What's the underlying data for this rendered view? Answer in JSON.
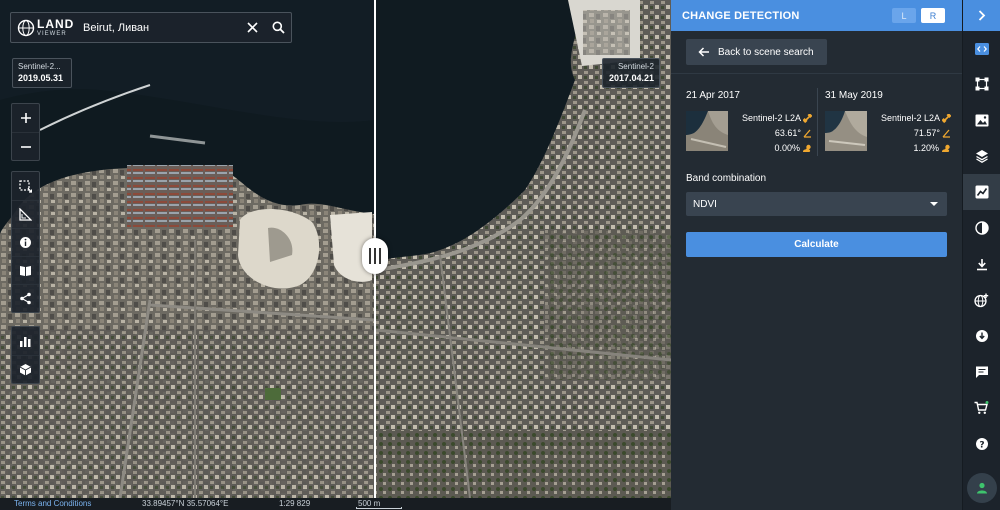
{
  "search": {
    "value": "Beirut, Ливан",
    "logo_line1": "LAND",
    "logo_line2": "VIEWER"
  },
  "map": {
    "left_scene": {
      "source": "Sentinel-2...",
      "date": "2019.05.31"
    },
    "right_scene": {
      "source": "Sentinel-2",
      "date": "2017.04.21"
    },
    "toolbar_top": [
      "zoom-in-icon",
      "zoom-out-icon"
    ],
    "toolbar_mid": [
      "select-area-icon",
      "ruler-icon",
      "info-icon",
      "book-icon",
      "share-icon"
    ],
    "toolbar_bot": [
      "bar-chart-icon",
      "cube-icon"
    ],
    "status": {
      "terms": "Terms and Conditions",
      "coords": "33.89457°N 35.57064°E",
      "scale": "1:29 829",
      "scalebar": "500 m"
    }
  },
  "panel": {
    "title": "CHANGE DETECTION",
    "left_toggle": "L",
    "right_toggle": "R",
    "back_label": "Back to scene search",
    "scene_a": {
      "date": "21 Apr 2017",
      "source": "Sentinel-2 L2A",
      "angle": "63.61°",
      "cloud": "0.00%"
    },
    "scene_b": {
      "date": "31 May 2019",
      "source": "Sentinel-2 L2A",
      "angle": "71.57°",
      "cloud": "1.20%"
    },
    "band_label": "Band combination",
    "band_value": "NDVI",
    "calculate_label": "Calculate"
  },
  "rail": [
    "code-icon",
    "polygon-icon",
    "image-icon",
    "layers-icon",
    "analytics-icon",
    "contrast-icon",
    "download-icon",
    "globe-add-icon",
    "download-circle-icon",
    "message-icon",
    "cart-icon",
    "help-icon",
    "user-icon"
  ],
  "colors": {
    "accent": "#4a8fe0",
    "panel": "#232b33",
    "rail": "#1c232b"
  }
}
